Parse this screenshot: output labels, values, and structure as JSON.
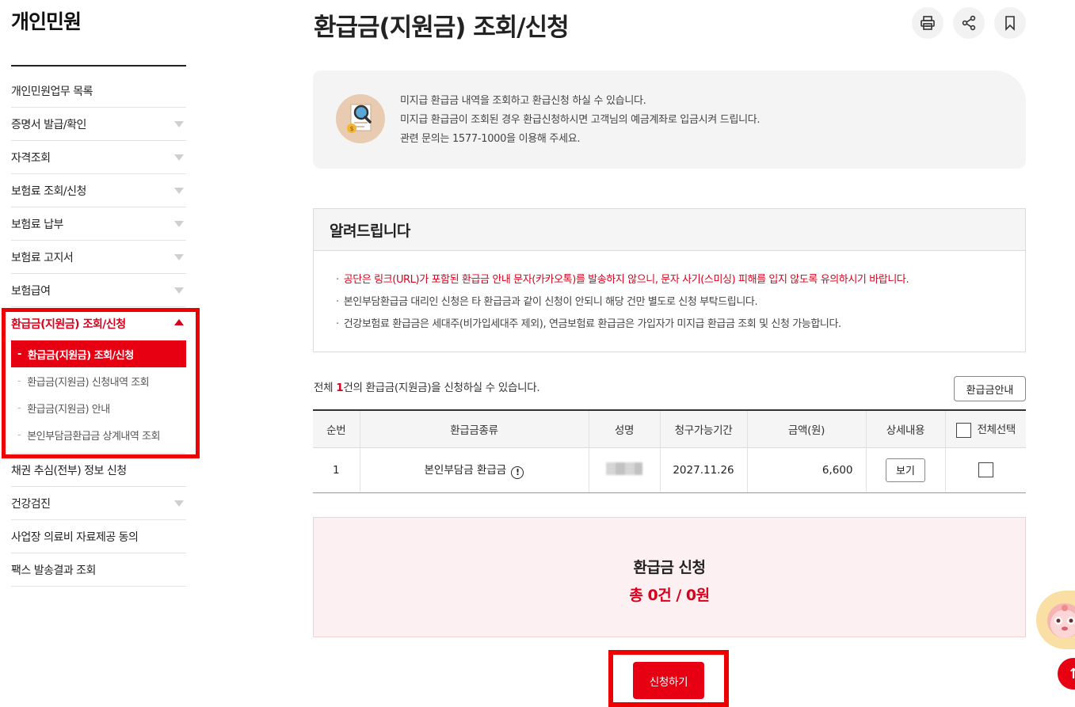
{
  "sidebar": {
    "title": "개인민원",
    "items": [
      {
        "label": "개인민원업무 목록",
        "expandable": false
      },
      {
        "label": "증명서 발급/확인",
        "expandable": true
      },
      {
        "label": "자격조회",
        "expandable": true
      },
      {
        "label": "보험료 조회/신청",
        "expandable": true
      },
      {
        "label": "보험료 납부",
        "expandable": true
      },
      {
        "label": "보험료 고지서",
        "expandable": true
      },
      {
        "label": "보험급여",
        "expandable": true
      }
    ],
    "active": {
      "label": "환급금(지원금) 조회/신청",
      "children": [
        {
          "label": "환급금(지원금) 조회/신청"
        },
        {
          "label": "환급금(지원금) 신청내역 조회"
        },
        {
          "label": "환급금(지원금) 안내"
        },
        {
          "label": "본인부담금환급금 상계내역 조회"
        }
      ]
    },
    "items_after": [
      {
        "label": "채권 추심(전부) 정보 신청",
        "expandable": false
      },
      {
        "label": "건강검진",
        "expandable": true
      },
      {
        "label": "사업장 의료비 자료제공 동의",
        "expandable": false
      },
      {
        "label": "팩스 발송결과 조회",
        "expandable": false
      }
    ]
  },
  "header": {
    "title": "환급금(지원금) 조회/신청",
    "icons": [
      "printer-icon",
      "share-icon",
      "bookmark-icon"
    ]
  },
  "info": {
    "line1": "미지급 환급금 내역을 조회하고 환급신청 하실 수 있습니다.",
    "line2": "미지급 환급금이 조회된 경우 환급신청하시면 고객님의 예금계좌로 입금시켜 드립니다.",
    "line3": "관련 문의는 1577-1000을 이용해 주세요."
  },
  "notice": {
    "title": "알려드립니다",
    "items": [
      "공단은 링크(URL)가 포함된 환급금 안내 문자(카카오톡)를 발송하지 않으니, 문자 사기(스미싱) 피해를 입지 않도록 유의하시기 바랍니다.",
      "본인부담환급금 대리인 신청은 타 환급금과 같이 신청이 안되니 해당 건만 별도로 신청 부탁드립니다.",
      "건강보험료 환급금은 세대주(비가입세대주 제외), 연금보험료 환급금은 가입자가 미지급 환급금 조회 및 신청 가능합니다."
    ]
  },
  "summary": {
    "prefix": "전체 ",
    "count": "1",
    "suffix": "건의 환급금(지원금)을 신청하실 수 있습니다.",
    "guide_button": "환급금안내"
  },
  "table": {
    "headers": [
      "순번",
      "환급금종류",
      "성명",
      "청구가능기간",
      "금액(원)",
      "상세내용",
      "전체선택"
    ],
    "rows": [
      {
        "no": "1",
        "type": "본인부담금 환급금",
        "name": "",
        "period": "2027.11.26",
        "amount": "6,600",
        "detail_button": "보기",
        "checked": false
      }
    ]
  },
  "apply": {
    "title": "환급금 신청",
    "total": "총 0건 / 0원",
    "button": "신청하기"
  },
  "colors": {
    "accent": "#e60012",
    "highlight_border": "#ee0000"
  }
}
